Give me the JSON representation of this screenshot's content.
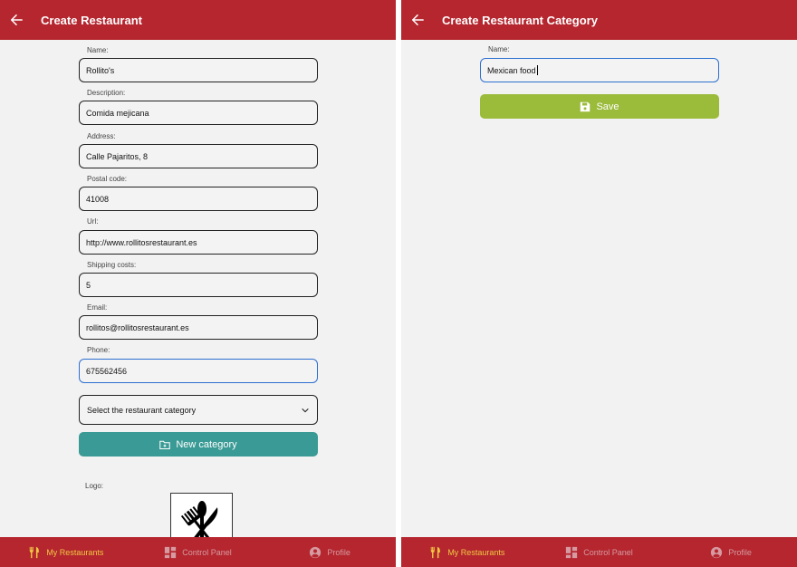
{
  "left_screen": {
    "title": "Create Restaurant",
    "fields": [
      {
        "label": "Name:",
        "value": "Rollito's"
      },
      {
        "label": "Description:",
        "value": "Comida mejicana"
      },
      {
        "label": "Address:",
        "value": "Calle Pajaritos, 8"
      },
      {
        "label": "Postal code:",
        "value": "41008"
      },
      {
        "label": "Url:",
        "value": "http://www.rollitosrestaurant.es"
      },
      {
        "label": "Shipping costs:",
        "value": "5"
      },
      {
        "label": "Email:",
        "value": "rollitos@rollitosrestaurant.es"
      },
      {
        "label": "Phone:",
        "value": "675562456"
      }
    ],
    "category_select": "Select the restaurant category",
    "new_category_button": "New category",
    "logo_label": "Logo:"
  },
  "right_screen": {
    "title": "Create Restaurant Category",
    "field": {
      "label": "Name:",
      "value": "Mexican food"
    },
    "save_button": "Save"
  },
  "tabbar": {
    "tabs": [
      {
        "label": "My Restaurants",
        "icon": "cutlery-icon",
        "active": true
      },
      {
        "label": "Control Panel",
        "icon": "dashboard-icon",
        "active": false
      },
      {
        "label": "Profile",
        "icon": "user-circle-icon",
        "active": false
      }
    ]
  },
  "colors": {
    "primary": "#b5262f",
    "accent_active": "#f0c843",
    "teal": "#3a9a95",
    "green": "#9bbb3b",
    "focus": "#2d6fd0",
    "background": "#f2f2f2"
  }
}
